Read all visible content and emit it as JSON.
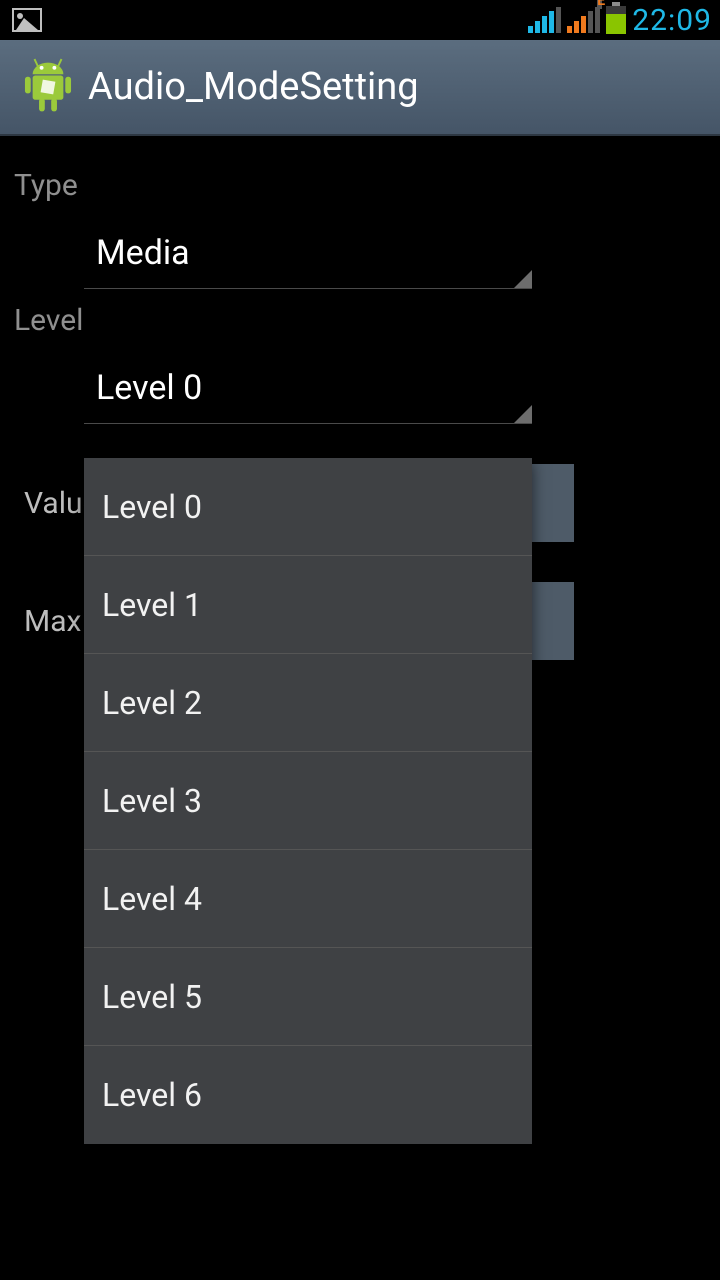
{
  "statusbar": {
    "time": "22:09",
    "edge_label": "E"
  },
  "actionbar": {
    "title": "Audio_ModeSetting"
  },
  "labels": {
    "type": "Type",
    "level": "Level",
    "value": "Value",
    "max": "Max Vol."
  },
  "spinners": {
    "type_selected": "Media",
    "level_selected": "Level 0"
  },
  "popup": {
    "items": [
      {
        "label": "Level 0"
      },
      {
        "label": "Level 1"
      },
      {
        "label": "Level 2"
      },
      {
        "label": "Level 3"
      },
      {
        "label": "Level 4"
      },
      {
        "label": "Level 5"
      },
      {
        "label": "Level 6"
      }
    ]
  }
}
